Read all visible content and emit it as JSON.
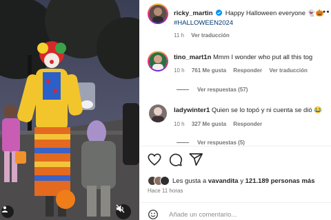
{
  "post": {
    "author": "ricky_martin",
    "verified": true,
    "caption": "Happy Halloween everyone",
    "caption_emojis": "👻🎃",
    "hashtag": "#HALLOWEEN2024",
    "time": "11 h",
    "translate": "Ver traducción"
  },
  "comments": [
    {
      "user": "tino_mart1n",
      "text": "Mmm I wonder who put all this tog",
      "time": "10 h",
      "likes": "761 Me gusta",
      "reply": "Responder",
      "translate": "Ver traducción",
      "view_replies": "Ver respuestas (57)"
    },
    {
      "user": "ladywinter1",
      "text": "Quien se lo topó y ni cuenta se dió",
      "emoji": "😂",
      "time": "10 h",
      "likes": "327 Me gusta",
      "reply": "Responder",
      "view_replies": "Ver respuestas (5)"
    }
  ],
  "likes_line": {
    "prefix": "Les gusta a",
    "user": "vavandita",
    "middle": "y",
    "count": "121.189 personas más"
  },
  "posted_ago": "Hace 11 horas",
  "add_comment_placeholder": "Añade un comentario...",
  "icons": [
    "more-icon",
    "heart-icon",
    "comment-icon",
    "share-icon",
    "mute-icon",
    "tag-user-icon",
    "emoji-icon",
    "verified-badge-icon"
  ],
  "colors": {
    "verified": "#0095f6",
    "hashtag": "#00376b",
    "secondary_text": "#737373",
    "like_red": "#ed4956"
  }
}
